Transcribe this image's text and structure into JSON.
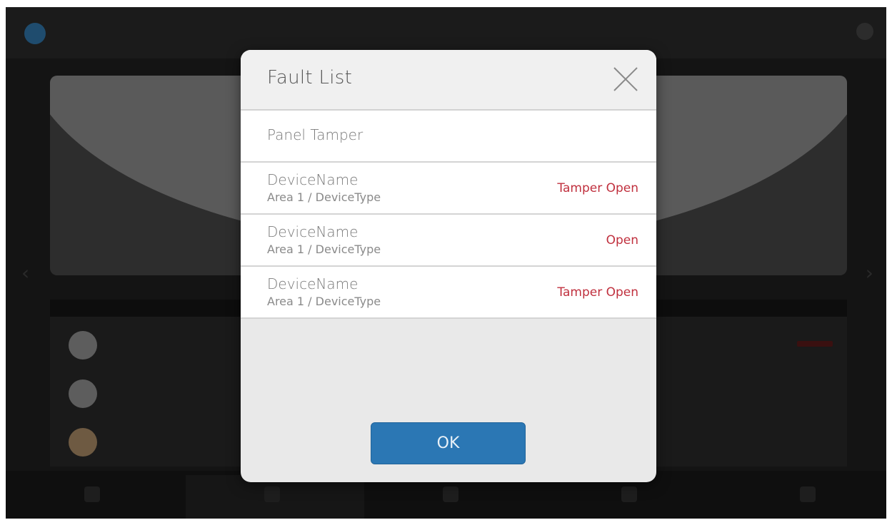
{
  "dialog": {
    "title": "Fault List",
    "ok_label": "OK"
  },
  "faults": [
    {
      "name": "Panel Tamper",
      "sub": "",
      "status": ""
    },
    {
      "name": "DeviceName",
      "sub": "Area 1 / DeviceType",
      "status": "Tamper Open"
    },
    {
      "name": "DeviceName",
      "sub": "Area 1 / DeviceType",
      "status": "Open"
    },
    {
      "name": "DeviceName",
      "sub": "Area 1 / DeviceType",
      "status": "Tamper Open"
    }
  ],
  "colors": {
    "accent": "#2b77b4",
    "fault_status": "#c0303e"
  }
}
